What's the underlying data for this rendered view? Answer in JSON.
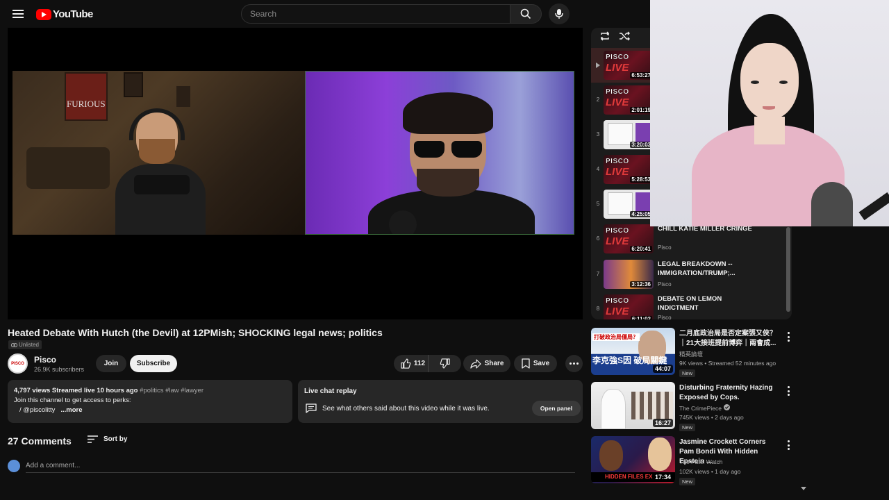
{
  "masthead": {
    "logo_text": "YouTube",
    "search_placeholder": "Search"
  },
  "video": {
    "title": "Heated Debate With Hutch (the Devil) at 12PMish; SHOCKING legal news; politics",
    "visibility": "Unlisted",
    "poster_text": "FURIOUS",
    "channel_name": "Pisco",
    "subscribers": "26.9K subscribers",
    "join_label": "Join",
    "subscribe_label": "Subscribe",
    "likes": "112",
    "share_label": "Share",
    "save_label": "Save"
  },
  "description": {
    "views_date": "4,797 views  Streamed live 10 hours ago",
    "tags": "#politics #law #lawyer",
    "line2": "Join this channel to get access to perks:",
    "line3": "/ @piscolitty",
    "more_label": "...more"
  },
  "live_chat": {
    "title": "Live chat replay",
    "text": "See what others said about this video while it was live.",
    "button": "Open panel"
  },
  "comments": {
    "count": "27 Comments",
    "sort_label": "Sort by",
    "placeholder": "Add a comment..."
  },
  "playlist": {
    "items": [
      {
        "num": "",
        "duration": "6:53:27",
        "title": "",
        "channel": "",
        "style": "live",
        "thumb_top": "PISCO",
        "thumb_bottom": "LIVE"
      },
      {
        "num": "2",
        "duration": "2:01:19",
        "title": "",
        "channel": "",
        "style": "live",
        "thumb_top": "PISCO",
        "thumb_bottom": "LIVE"
      },
      {
        "num": "3",
        "duration": "3:20:03",
        "title": "",
        "channel": "",
        "style": "doc",
        "thumb_top": "",
        "thumb_bottom": ""
      },
      {
        "num": "4",
        "duration": "5:28:53",
        "title": "",
        "channel": "",
        "style": "live",
        "thumb_top": "PISCO",
        "thumb_bottom": "LIVE"
      },
      {
        "num": "5",
        "duration": "4:25:05",
        "title": "",
        "channel": "",
        "style": "doc",
        "thumb_top": "",
        "thumb_bottom": ""
      },
      {
        "num": "6",
        "duration": "6:20:41",
        "title": "CHILL KATIE MILLER CRINGE",
        "channel": "Pisco",
        "style": "live",
        "thumb_top": "PISCO",
        "thumb_bottom": "LIVE"
      },
      {
        "num": "7",
        "duration": "3:12:36",
        "title": "LEGAL BREAKDOWN -- IMMIGRATION/TRUMP;...",
        "channel": "Pisco",
        "style": "debate",
        "thumb_top": "",
        "thumb_bottom": ""
      },
      {
        "num": "8",
        "duration": "6:11:02",
        "title": "DEBATE ON LEMON INDICTMENT",
        "channel": "Pisco",
        "style": "live",
        "thumb_top": "PISCO",
        "thumb_bottom": "LIVE"
      }
    ]
  },
  "recommendations": [
    {
      "title": "二月底政治局是否定案張又俠？｜21大接班提前博弈｜兩會成...",
      "channel": "精英論壇",
      "meta": "9K views • Streamed 52 minutes ago",
      "badge": "New",
      "duration": "44:07",
      "verified": false,
      "thumb_top": "打破政治局僵局？",
      "thumb_big": "李克強S因 破局關鍵"
    },
    {
      "title": "Disturbing Fraternity Hazing Exposed by Cops.",
      "channel": "The CrimePiece",
      "meta": "745K views • 2 days ago",
      "badge": "New",
      "duration": "16:27",
      "verified": true,
      "thumb_top": "",
      "thumb_big": ""
    },
    {
      "title": "Jasmine Crockett Corners Pam Bondi With Hidden Epstein ...",
      "channel": "The Patel Watch",
      "meta": "102K views • 1 day ago",
      "badge": "New",
      "duration": "17:34",
      "verified": false,
      "thumb_top": "",
      "thumb_big": "HIDDEN FILES EX"
    }
  ],
  "colors": {
    "background": "#0f0f0f",
    "surface": "#272727",
    "brand_red": "#ff0000",
    "text_primary": "#f1f1f1",
    "text_secondary": "#aaaaaa"
  }
}
